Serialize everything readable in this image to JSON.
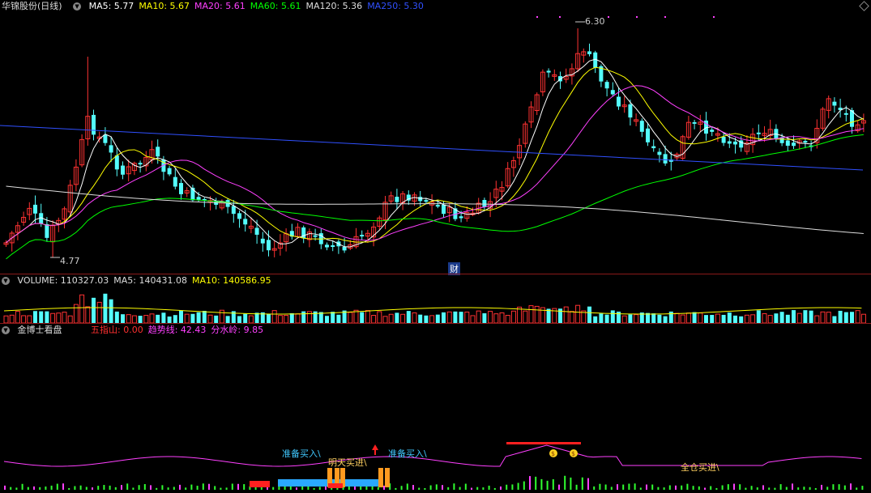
{
  "main": {
    "title": "华锦股份(日线)",
    "indicators": [
      {
        "label": "MA5: 5.77",
        "color": "#ffffff"
      },
      {
        "label": "MA10: 5.67",
        "color": "#ffff00"
      },
      {
        "label": "MA20: 5.61",
        "color": "#ff40ff"
      },
      {
        "label": "MA60: 5.61",
        "color": "#00ff00"
      },
      {
        "label": "MA120: 5.36",
        "color": "#dddddd"
      },
      {
        "label": "MA250: 5.30",
        "color": "#3050ff"
      }
    ],
    "high_label": "6.30",
    "low_label": "4.77",
    "finance_mark": "财"
  },
  "volume": {
    "indicators": [
      {
        "label": "VOLUME: 110327.03",
        "color": "#dddddd"
      },
      {
        "label": "MA5: 140431.08",
        "color": "#dddddd"
      },
      {
        "label": "MA10: 140586.95",
        "color": "#ffff00"
      }
    ]
  },
  "jbs": {
    "title": "金博士看盘",
    "indicators": [
      {
        "label": "五指山: 0.00",
        "color": "#ff3030"
      },
      {
        "label": "趋势线: 42.43",
        "color": "#ff40ff"
      },
      {
        "label": "分水岭: 9.85",
        "color": "#ff40ff"
      }
    ],
    "signals": {
      "prep_buy_1": "准备买入\\",
      "tomorrow_buy": "明天买进\\",
      "prep_buy_2": "准备买入\\",
      "full_buy": "全仓买进\\"
    }
  },
  "colors": {
    "up": "#ff3232",
    "down": "#54fcfc",
    "grid": "#8b1a1a"
  }
}
